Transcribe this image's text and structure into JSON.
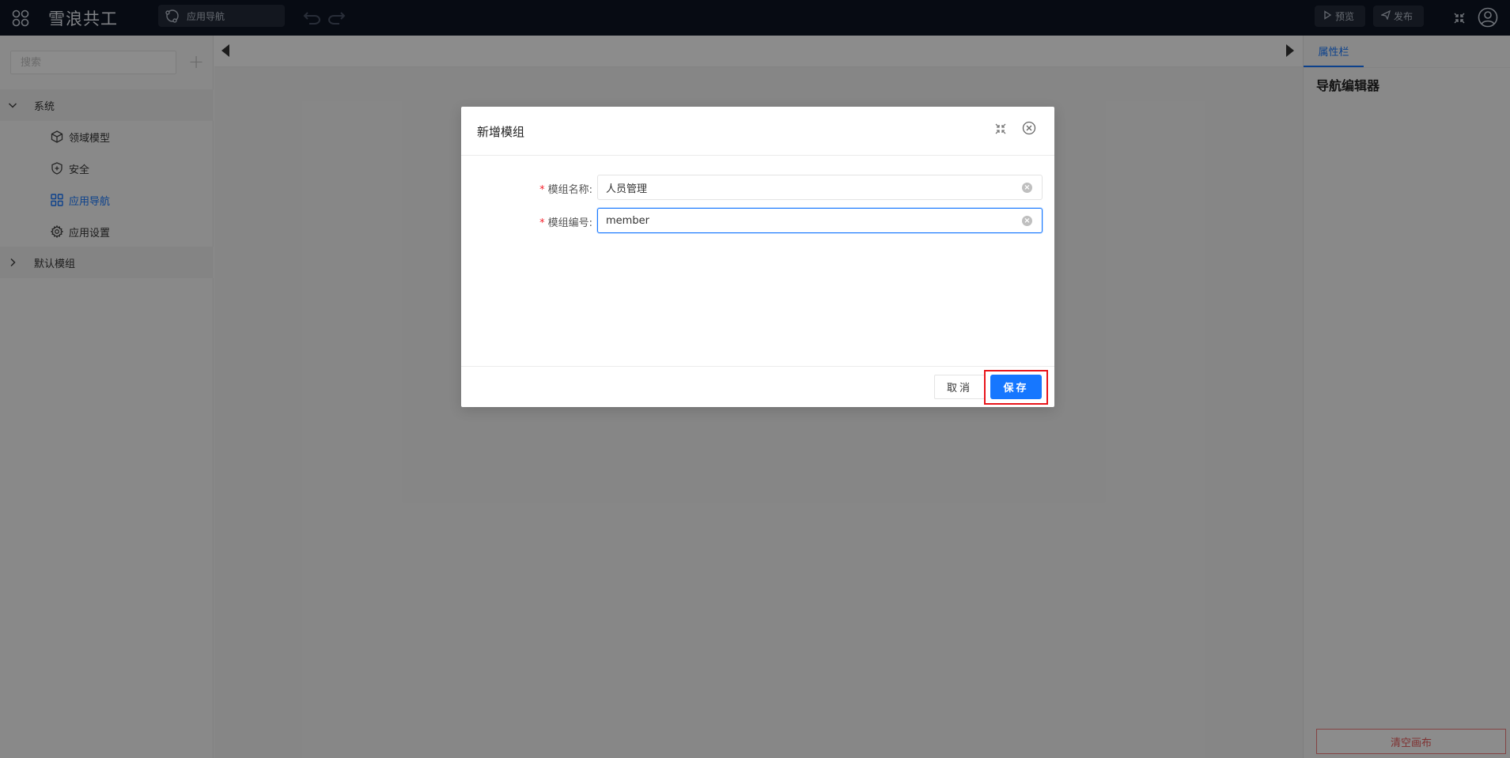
{
  "topbar": {
    "app_title": "雪浪共工",
    "nav_select_label": "应用导航",
    "preview_label": "预览",
    "publish_label": "发布"
  },
  "sidebar": {
    "search_placeholder": "搜索",
    "groups": [
      {
        "label": "系统",
        "expanded": true,
        "items": [
          {
            "label": "领域模型",
            "icon": "cube-icon"
          },
          {
            "label": "安全",
            "icon": "shield-plus-icon"
          },
          {
            "label": "应用导航",
            "icon": "grid-icon",
            "active": true
          },
          {
            "label": "应用设置",
            "icon": "gear-icon"
          }
        ]
      },
      {
        "label": "默认模组",
        "expanded": false
      }
    ]
  },
  "right_panel": {
    "tab_label": "属性栏",
    "title": "导航编辑器",
    "clear_button_label": "清空画布"
  },
  "modal": {
    "title": "新增模组",
    "fields": [
      {
        "label": "模组名称:",
        "required": true,
        "value": "人员管理"
      },
      {
        "label": "模组编号:",
        "required": true,
        "value": "member",
        "focused": true
      }
    ],
    "cancel_label": "取消",
    "save_label": "保存"
  },
  "colors": {
    "topbar_bg": "#0e1524",
    "accent": "#1677ff",
    "danger": "#e85a5a",
    "highlight_box": "#e8151b"
  }
}
